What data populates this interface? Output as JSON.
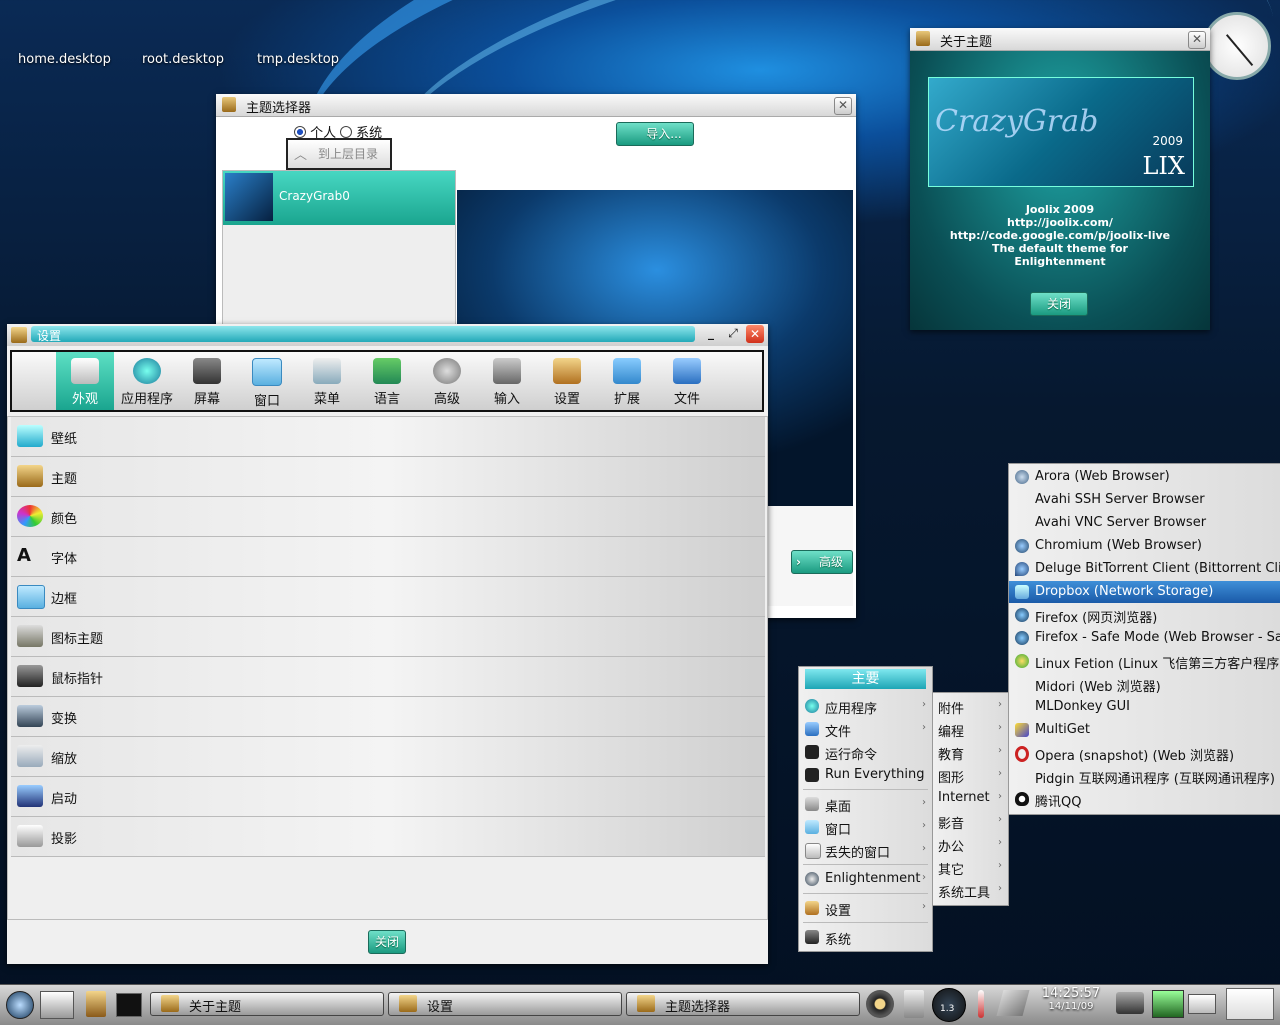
{
  "desktop": {
    "icons": [
      "home.desktop",
      "root.desktop",
      "tmp.desktop"
    ]
  },
  "about_window": {
    "title": "关于主题",
    "logo_text": "CrazyGrab",
    "logo_year": "2009",
    "logo_sub": "LIX",
    "lines": [
      "Joolix 2009",
      "http://joolix.com/",
      "http://code.google.com/p/joolix-live",
      "The default theme for",
      "Enlightenment"
    ],
    "close_label": "关闭"
  },
  "theme_window": {
    "title": "主题选择器",
    "radio_personal": "个人",
    "radio_system": "系统",
    "up_label": "到上层目录",
    "import_label": "导入...",
    "theme_item": "CrazyGrab0",
    "advanced_label": "高级"
  },
  "settings_window": {
    "title": "设置",
    "toolbar": [
      "外观",
      "应用程序",
      "屏幕",
      "窗口",
      "菜单",
      "语言",
      "高级",
      "输入",
      "设置",
      "扩展",
      "文件"
    ],
    "items": [
      "壁纸",
      "主题",
      "颜色",
      "字体",
      "边框",
      "图标主题",
      "鼠标指针",
      "变换",
      "缩放",
      "启动",
      "投影"
    ],
    "close_label": "关闭"
  },
  "main_menu": {
    "header": "主要",
    "items": [
      "应用程序",
      "文件",
      "运行命令",
      "Run Everything",
      "桌面",
      "窗口",
      "丢失的窗口",
      "Enlightenment",
      "设置",
      "系统"
    ]
  },
  "apps_submenu": [
    "附件",
    "编程",
    "教育",
    "图形",
    "Internet",
    "影音",
    "办公",
    "其它",
    "系统工具"
  ],
  "internet_submenu": [
    "Arora (Web Browser)",
    "Avahi SSH Server Browser",
    "Avahi VNC Server Browser",
    "Chromium (Web Browser)",
    "Deluge BitTorrent Client (Bittorrent Client)",
    "Dropbox (Network Storage)",
    "Firefox (网页浏览器)",
    "Firefox - Safe Mode (Web Browser - Safe M",
    "Linux Fetion (Linux 飞信第三方客户程序)",
    "Midori (Web 浏览器)",
    "MLDonkey GUI",
    "MultiGet",
    "Opera (snapshot) (Web 浏览器)",
    "Pidgin 互联网通讯程序 (互联网通讯程序)",
    "腾讯QQ"
  ],
  "taskbar": {
    "tasks": [
      "关于主题",
      "设置",
      "主题选择器"
    ],
    "time": "14:25:57",
    "date": "14/11/09",
    "gauge": "1.3"
  },
  "colors": {
    "accent": "#1fc2a8",
    "highlight": "#1f6fc0"
  }
}
